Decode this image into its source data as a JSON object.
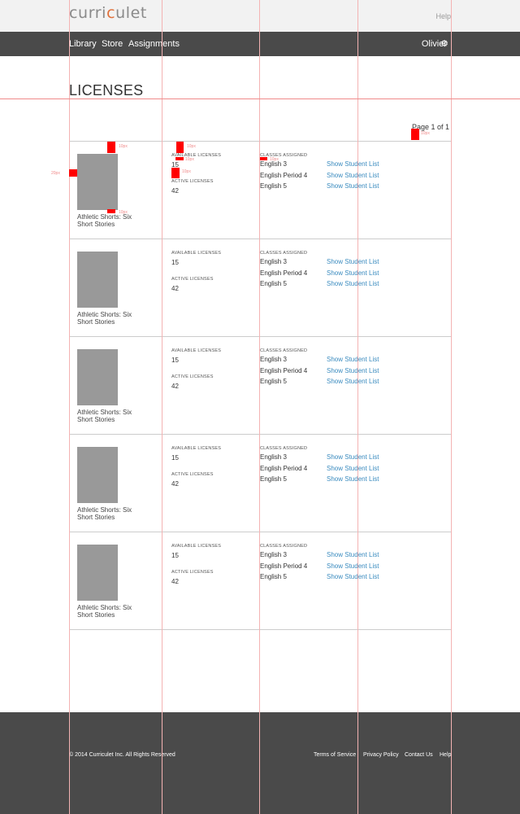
{
  "header": {
    "logo_text_a": "curri",
    "logo_text_b": "c",
    "logo_text_c": "ulet",
    "help_label": "Help"
  },
  "nav": {
    "items": [
      "Library",
      "Store",
      "Assignments"
    ],
    "user_name": "Olivier",
    "gear_icon": "gear-icon"
  },
  "page": {
    "title": "LICENSES",
    "pager": "Page 1 of 1"
  },
  "labels": {
    "available": "AVAILABLE LICENSES",
    "active": "ACTIVE LICENSES",
    "classes": "CLASSES ASSIGNED"
  },
  "rows": [
    {
      "book_title": "Athletic Shorts: Six Short Stories",
      "available": "15",
      "active": "42",
      "classes": [
        "English 3",
        "English Period 4",
        "English 5"
      ],
      "link_label": "Show Student List"
    },
    {
      "book_title": "Athletic Shorts: Six Short Stories",
      "available": "15",
      "active": "42",
      "classes": [
        "English 3",
        "English Period 4",
        "English 5"
      ],
      "link_label": "Show Student List"
    },
    {
      "book_title": "Athletic Shorts: Six Short Stories",
      "available": "15",
      "active": "42",
      "classes": [
        "English 3",
        "English Period 4",
        "English 5"
      ],
      "link_label": "Show Student List"
    },
    {
      "book_title": "Athletic Shorts: Six Short Stories",
      "available": "15",
      "active": "42",
      "classes": [
        "English 3",
        "English Period 4",
        "English 5"
      ],
      "link_label": "Show Student List"
    },
    {
      "book_title": "Athletic Shorts: Six Short Stories",
      "available": "15",
      "active": "42",
      "classes": [
        "English 3",
        "English Period 4",
        "English 5"
      ],
      "link_label": "Show Student List"
    }
  ],
  "annotations": {
    "m10": "10px",
    "m20": "20px"
  },
  "footer": {
    "copyright": "© 2014 Curriculet Inc. All Rights Reserved",
    "links": [
      "Terms of Service",
      "Privacy Policy",
      "Contact Us",
      "Help"
    ]
  },
  "colors": {
    "nav_bg": "#4a4a4a",
    "top_bg": "#f2f2f2",
    "link": "#3a8bbf",
    "guide": "#ff0000"
  }
}
